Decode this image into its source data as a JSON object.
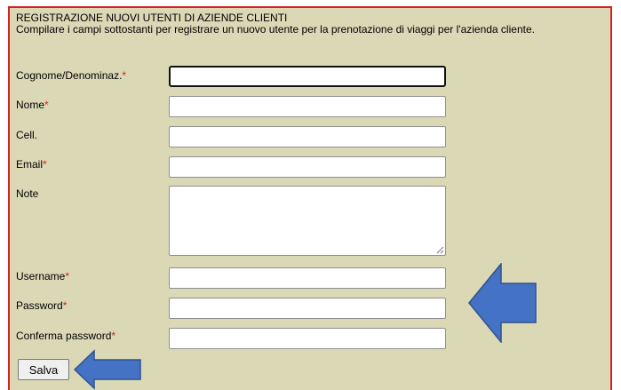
{
  "form": {
    "title": "REGISTRAZIONE NUOVI UTENTI DI AZIENDE CLIENTI",
    "subtitle": "Compilare i campi sottostanti per registrare un nuovo utente per la prenotazione di viaggi per l'azienda cliente.",
    "required_mark": "*",
    "fields": {
      "cognome": {
        "label": "Cognome/Denominaz.",
        "value": ""
      },
      "nome": {
        "label": "Nome",
        "value": ""
      },
      "cell": {
        "label": "Cell.",
        "value": ""
      },
      "email": {
        "label": "Email",
        "value": ""
      },
      "note": {
        "label": "Note",
        "value": ""
      },
      "username": {
        "label": "Username",
        "value": ""
      },
      "password": {
        "label": "Password",
        "value": ""
      },
      "conferma": {
        "label": "Conferma password",
        "value": ""
      }
    },
    "save_label": "Salva"
  },
  "annotations": {
    "arrow_color": "#4472c4",
    "arrow_stroke": "#2f528f"
  },
  "colors": {
    "panel_background": "#dbd8b6",
    "panel_border": "#d42020",
    "required_mark": "#d42020"
  }
}
